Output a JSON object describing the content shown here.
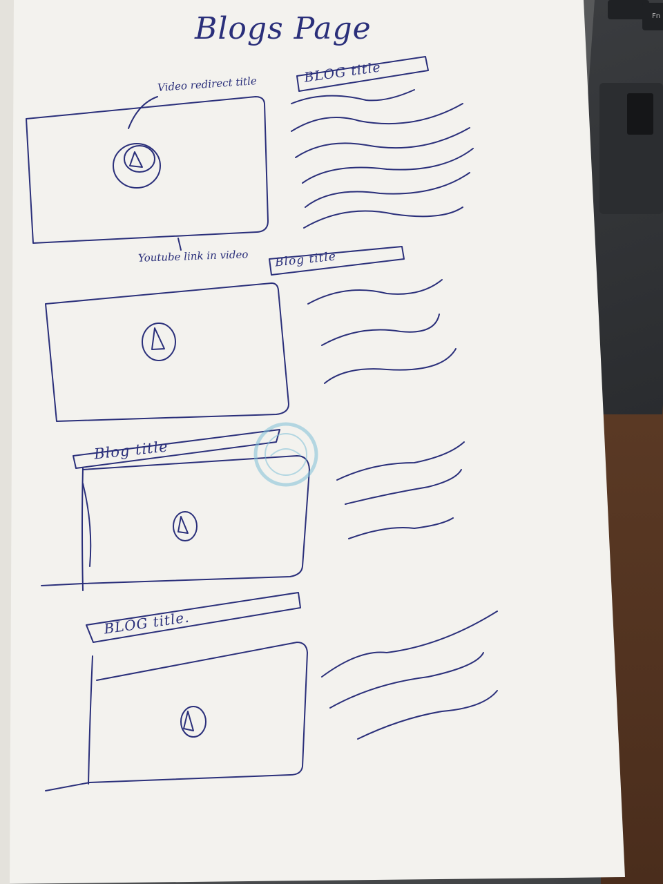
{
  "page": {
    "title": "Blogs Page"
  },
  "annotations": {
    "video_redirect": "Video redirect title",
    "youtube_link": "Youtube link in video"
  },
  "blog_titles": [
    "BLOG title",
    "Blog title",
    "Blog title",
    "BLOG title."
  ],
  "laptop": {
    "fn_key": "Fn"
  },
  "colors": {
    "ink": "#2a2f7a",
    "paper": "#f3f2ee",
    "stamp": "#7fc0d8"
  }
}
